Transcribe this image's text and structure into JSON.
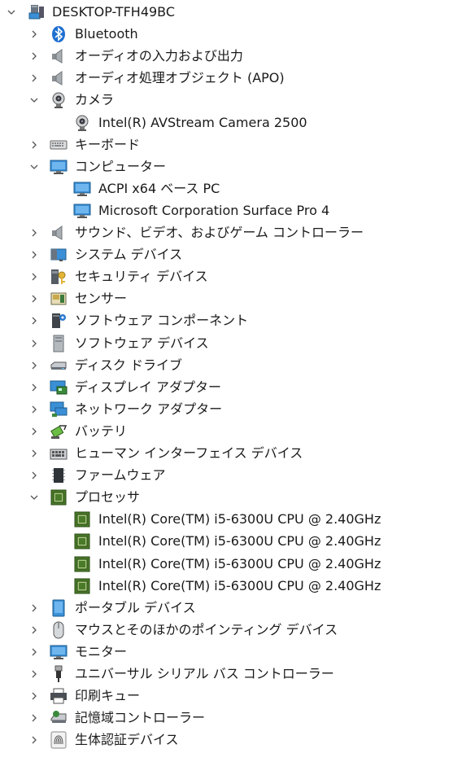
{
  "root": {
    "label": "DESKTOP-TFH49BC",
    "icon": "computer-icon",
    "expanded": true
  },
  "nodes": [
    {
      "label": "Bluetooth",
      "icon": "bluetooth-icon",
      "expanded": false,
      "children": []
    },
    {
      "label": "オーディオの入力および出力",
      "icon": "speaker-icon",
      "expanded": false,
      "children": []
    },
    {
      "label": "オーディオ処理オブジェクト (APO)",
      "icon": "speaker-icon",
      "expanded": false,
      "children": []
    },
    {
      "label": "カメラ",
      "icon": "webcam-icon",
      "expanded": true,
      "children": [
        {
          "label": "Intel(R) AVStream Camera 2500",
          "icon": "webcam-icon"
        }
      ]
    },
    {
      "label": "キーボード",
      "icon": "keyboard-icon",
      "expanded": false,
      "children": []
    },
    {
      "label": "コンピューター",
      "icon": "monitor-icon",
      "expanded": true,
      "children": [
        {
          "label": "ACPI x64 ベース PC",
          "icon": "monitor-icon"
        },
        {
          "label": "Microsoft Corporation Surface Pro 4",
          "icon": "monitor-icon"
        }
      ]
    },
    {
      "label": "サウンド、ビデオ、およびゲーム コントローラー",
      "icon": "speaker-icon",
      "expanded": false,
      "children": []
    },
    {
      "label": "システム デバイス",
      "icon": "system-device-icon",
      "expanded": false,
      "children": []
    },
    {
      "label": "セキュリティ デバイス",
      "icon": "security-key-icon",
      "expanded": false,
      "children": []
    },
    {
      "label": "センサー",
      "icon": "sensor-icon",
      "expanded": false,
      "children": []
    },
    {
      "label": "ソフトウェア コンポーネント",
      "icon": "software-component-icon",
      "expanded": false,
      "children": []
    },
    {
      "label": "ソフトウェア デバイス",
      "icon": "software-device-icon",
      "expanded": false,
      "children": []
    },
    {
      "label": "ディスク ドライブ",
      "icon": "disk-drive-icon",
      "expanded": false,
      "children": []
    },
    {
      "label": "ディスプレイ アダプター",
      "icon": "display-adapter-icon",
      "expanded": false,
      "children": []
    },
    {
      "label": "ネットワーク アダプター",
      "icon": "network-adapter-icon",
      "expanded": false,
      "children": []
    },
    {
      "label": "バッテリ",
      "icon": "battery-icon",
      "expanded": false,
      "children": []
    },
    {
      "label": "ヒューマン インターフェイス デバイス",
      "icon": "hid-keyboard-icon",
      "expanded": false,
      "children": []
    },
    {
      "label": "ファームウェア",
      "icon": "firmware-chip-icon",
      "expanded": false,
      "children": []
    },
    {
      "label": "プロセッサ",
      "icon": "processor-icon",
      "expanded": true,
      "children": [
        {
          "label": "Intel(R) Core(TM) i5-6300U CPU @ 2.40GHz",
          "icon": "processor-icon"
        },
        {
          "label": "Intel(R) Core(TM) i5-6300U CPU @ 2.40GHz",
          "icon": "processor-icon"
        },
        {
          "label": "Intel(R) Core(TM) i5-6300U CPU @ 2.40GHz",
          "icon": "processor-icon"
        },
        {
          "label": "Intel(R) Core(TM) i5-6300U CPU @ 2.40GHz",
          "icon": "processor-icon"
        }
      ]
    },
    {
      "label": "ポータブル デバイス",
      "icon": "portable-device-icon",
      "expanded": false,
      "children": []
    },
    {
      "label": "マウスとそのほかのポインティング デバイス",
      "icon": "mouse-icon",
      "expanded": false,
      "children": []
    },
    {
      "label": "モニター",
      "icon": "monitor-icon",
      "expanded": false,
      "children": []
    },
    {
      "label": "ユニバーサル シリアル バス コントローラー",
      "icon": "usb-icon",
      "expanded": false,
      "children": []
    },
    {
      "label": "印刷キュー",
      "icon": "printer-icon",
      "expanded": false,
      "children": []
    },
    {
      "label": "記憶域コントローラー",
      "icon": "storage-controller-icon",
      "expanded": false,
      "children": []
    },
    {
      "label": "生体認証デバイス",
      "icon": "fingerprint-icon",
      "expanded": false,
      "children": []
    }
  ],
  "colors": {
    "chevron": "#555555",
    "text": "#1a1a1a",
    "background": "#ffffff",
    "monitor_blue": "#3a8fd6",
    "chip_green": "#4a7a2a"
  }
}
